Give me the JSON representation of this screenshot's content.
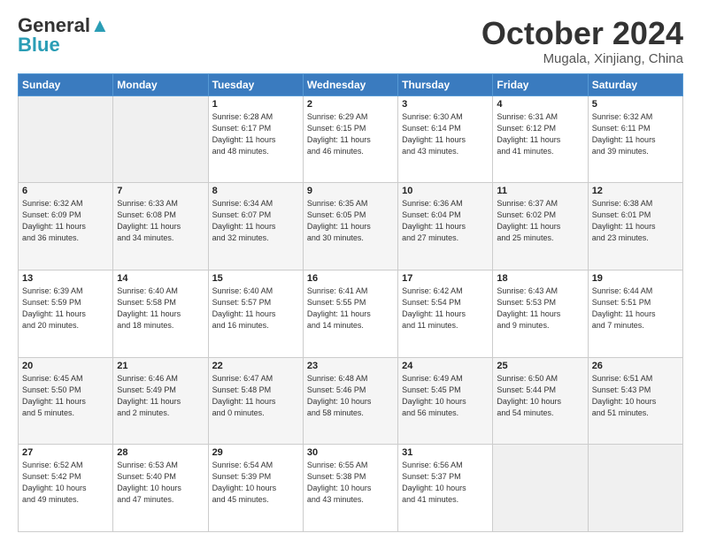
{
  "header": {
    "logo_line1": "General",
    "logo_line2": "Blue",
    "month": "October 2024",
    "location": "Mugala, Xinjiang, China"
  },
  "weekdays": [
    "Sunday",
    "Monday",
    "Tuesday",
    "Wednesday",
    "Thursday",
    "Friday",
    "Saturday"
  ],
  "weeks": [
    [
      {
        "day": "",
        "info": ""
      },
      {
        "day": "",
        "info": ""
      },
      {
        "day": "1",
        "info": "Sunrise: 6:28 AM\nSunset: 6:17 PM\nDaylight: 11 hours\nand 48 minutes."
      },
      {
        "day": "2",
        "info": "Sunrise: 6:29 AM\nSunset: 6:15 PM\nDaylight: 11 hours\nand 46 minutes."
      },
      {
        "day": "3",
        "info": "Sunrise: 6:30 AM\nSunset: 6:14 PM\nDaylight: 11 hours\nand 43 minutes."
      },
      {
        "day": "4",
        "info": "Sunrise: 6:31 AM\nSunset: 6:12 PM\nDaylight: 11 hours\nand 41 minutes."
      },
      {
        "day": "5",
        "info": "Sunrise: 6:32 AM\nSunset: 6:11 PM\nDaylight: 11 hours\nand 39 minutes."
      }
    ],
    [
      {
        "day": "6",
        "info": "Sunrise: 6:32 AM\nSunset: 6:09 PM\nDaylight: 11 hours\nand 36 minutes."
      },
      {
        "day": "7",
        "info": "Sunrise: 6:33 AM\nSunset: 6:08 PM\nDaylight: 11 hours\nand 34 minutes."
      },
      {
        "day": "8",
        "info": "Sunrise: 6:34 AM\nSunset: 6:07 PM\nDaylight: 11 hours\nand 32 minutes."
      },
      {
        "day": "9",
        "info": "Sunrise: 6:35 AM\nSunset: 6:05 PM\nDaylight: 11 hours\nand 30 minutes."
      },
      {
        "day": "10",
        "info": "Sunrise: 6:36 AM\nSunset: 6:04 PM\nDaylight: 11 hours\nand 27 minutes."
      },
      {
        "day": "11",
        "info": "Sunrise: 6:37 AM\nSunset: 6:02 PM\nDaylight: 11 hours\nand 25 minutes."
      },
      {
        "day": "12",
        "info": "Sunrise: 6:38 AM\nSunset: 6:01 PM\nDaylight: 11 hours\nand 23 minutes."
      }
    ],
    [
      {
        "day": "13",
        "info": "Sunrise: 6:39 AM\nSunset: 5:59 PM\nDaylight: 11 hours\nand 20 minutes."
      },
      {
        "day": "14",
        "info": "Sunrise: 6:40 AM\nSunset: 5:58 PM\nDaylight: 11 hours\nand 18 minutes."
      },
      {
        "day": "15",
        "info": "Sunrise: 6:40 AM\nSunset: 5:57 PM\nDaylight: 11 hours\nand 16 minutes."
      },
      {
        "day": "16",
        "info": "Sunrise: 6:41 AM\nSunset: 5:55 PM\nDaylight: 11 hours\nand 14 minutes."
      },
      {
        "day": "17",
        "info": "Sunrise: 6:42 AM\nSunset: 5:54 PM\nDaylight: 11 hours\nand 11 minutes."
      },
      {
        "day": "18",
        "info": "Sunrise: 6:43 AM\nSunset: 5:53 PM\nDaylight: 11 hours\nand 9 minutes."
      },
      {
        "day": "19",
        "info": "Sunrise: 6:44 AM\nSunset: 5:51 PM\nDaylight: 11 hours\nand 7 minutes."
      }
    ],
    [
      {
        "day": "20",
        "info": "Sunrise: 6:45 AM\nSunset: 5:50 PM\nDaylight: 11 hours\nand 5 minutes."
      },
      {
        "day": "21",
        "info": "Sunrise: 6:46 AM\nSunset: 5:49 PM\nDaylight: 11 hours\nand 2 minutes."
      },
      {
        "day": "22",
        "info": "Sunrise: 6:47 AM\nSunset: 5:48 PM\nDaylight: 11 hours\nand 0 minutes."
      },
      {
        "day": "23",
        "info": "Sunrise: 6:48 AM\nSunset: 5:46 PM\nDaylight: 10 hours\nand 58 minutes."
      },
      {
        "day": "24",
        "info": "Sunrise: 6:49 AM\nSunset: 5:45 PM\nDaylight: 10 hours\nand 56 minutes."
      },
      {
        "day": "25",
        "info": "Sunrise: 6:50 AM\nSunset: 5:44 PM\nDaylight: 10 hours\nand 54 minutes."
      },
      {
        "day": "26",
        "info": "Sunrise: 6:51 AM\nSunset: 5:43 PM\nDaylight: 10 hours\nand 51 minutes."
      }
    ],
    [
      {
        "day": "27",
        "info": "Sunrise: 6:52 AM\nSunset: 5:42 PM\nDaylight: 10 hours\nand 49 minutes."
      },
      {
        "day": "28",
        "info": "Sunrise: 6:53 AM\nSunset: 5:40 PM\nDaylight: 10 hours\nand 47 minutes."
      },
      {
        "day": "29",
        "info": "Sunrise: 6:54 AM\nSunset: 5:39 PM\nDaylight: 10 hours\nand 45 minutes."
      },
      {
        "day": "30",
        "info": "Sunrise: 6:55 AM\nSunset: 5:38 PM\nDaylight: 10 hours\nand 43 minutes."
      },
      {
        "day": "31",
        "info": "Sunrise: 6:56 AM\nSunset: 5:37 PM\nDaylight: 10 hours\nand 41 minutes."
      },
      {
        "day": "",
        "info": ""
      },
      {
        "day": "",
        "info": ""
      }
    ]
  ]
}
